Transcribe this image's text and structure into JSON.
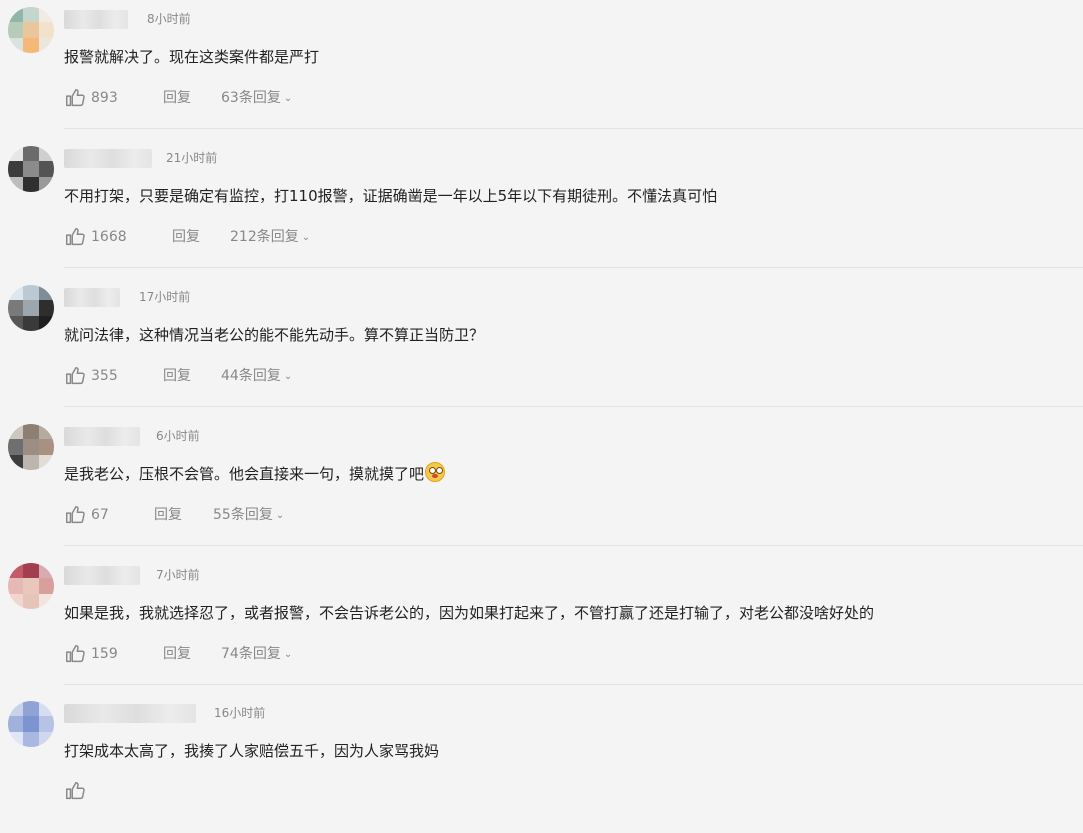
{
  "comments": [
    {
      "time": "8小时前",
      "text": "报警就解决了。现在这类案件都是严打",
      "likes": "893",
      "reply_label": "回复",
      "replies_label": "63条回复",
      "avatar_colors": [
        "#8fb6a9",
        "#c4d6cd",
        "#f0ebe4",
        "#b7cbb9",
        "#eac79a",
        "#f2e2cc",
        "#d9e2dc",
        "#f5b879",
        "#ede6dc"
      ]
    },
    {
      "time": "21小时前",
      "text": "不用打架，只要是确定有监控，打110报警，证据确凿是一年以上5年以下有期徒刑。不懂法真可怕",
      "likes": "1668",
      "reply_label": "回复",
      "replies_label": "212条回复",
      "avatar_colors": [
        "#e7e7e7",
        "#6b6b6b",
        "#cfcfcf",
        "#3c3c3c",
        "#8b8b8b",
        "#545454",
        "#bdbdbd",
        "#2f2f2f",
        "#9a9a9a"
      ]
    },
    {
      "time": "17小时前",
      "text": "就问法律，这种情况当老公的能不能先动手。算不算正当防卫？",
      "likes": "355",
      "reply_label": "回复",
      "replies_label": "44条回复",
      "avatar_colors": [
        "#dfe7ee",
        "#bcc9d2",
        "#7f8d98",
        "#7a7a7a",
        "#9ba6ae",
        "#2e2e2e",
        "#575757",
        "#3a3a3a",
        "#1f1f1f"
      ]
    },
    {
      "time": "6小时前",
      "text": "是我老公，压根不会管。他会直接来一句，摸就摸了吧",
      "likes": "67",
      "reply_label": "回复",
      "replies_label": "55条回复",
      "avatar_colors": [
        "#cdc7c2",
        "#8d7f74",
        "#b6aba0",
        "#6f6f6f",
        "#9c8e83",
        "#a99181",
        "#3d3d3d",
        "#bcb6af",
        "#e2dcd6"
      ]
    },
    {
      "time": "7小时前",
      "text": "如果是我，我就选择忍了，或者报警，不会告诉老公的，因为如果打起来了，不管打赢了还是打输了，对老公都没啥好处的",
      "likes": "159",
      "reply_label": "回复",
      "replies_label": "74条回复",
      "avatar_colors": [
        "#c45a67",
        "#a33e4e",
        "#d9aab0",
        "#e6b8b6",
        "#e9c7bd",
        "#d8a09a",
        "#f0d6cf",
        "#e7c4ba",
        "#f3e4de"
      ]
    },
    {
      "time": "16小时前",
      "text": "打架成本太高了，我揍了人家赔偿五千，因为人家骂我妈",
      "likes": "",
      "reply_label": "",
      "replies_label": "",
      "avatar_colors": [
        "#c8d2ea",
        "#8fa3d4",
        "#d6ddf0",
        "#9fb1dc",
        "#7c94cf",
        "#b6c3e4",
        "#e0e6f4",
        "#a8b8e0",
        "#cfd8ee"
      ]
    }
  ],
  "emoji_name": "pleading-face-emoji"
}
